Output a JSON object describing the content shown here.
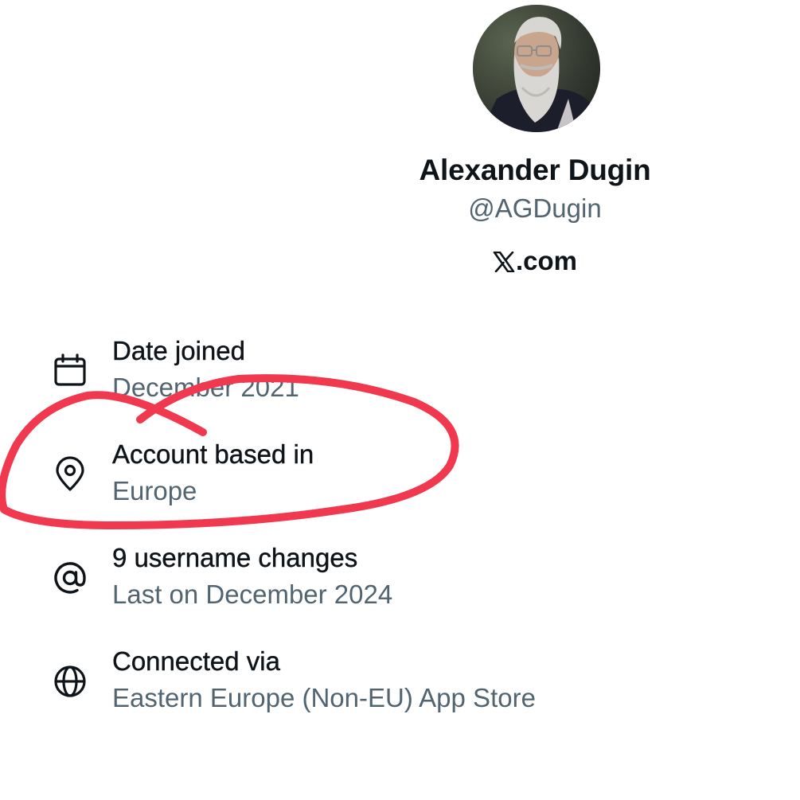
{
  "profile": {
    "name": "Alexander Dugin",
    "handle": "@AGDugin",
    "source_domain": ".com",
    "source_logo_icon": "x-logo-icon",
    "avatar_icon": "avatar-photo"
  },
  "details": [
    {
      "icon": "calendar-icon",
      "title": "Date joined",
      "value": "December 2021"
    },
    {
      "icon": "location-pin-icon",
      "title": "Account based in",
      "value": "Europe"
    },
    {
      "icon": "at-sign-icon",
      "title": "9 username changes",
      "value": "Last on December 2024"
    },
    {
      "icon": "globe-icon",
      "title": "Connected via",
      "value": "Eastern Europe (Non-EU) App Store"
    }
  ],
  "colors": {
    "primary_text": "#0f1419",
    "secondary_text": "#536471",
    "annotation_red": "#f0394f"
  }
}
